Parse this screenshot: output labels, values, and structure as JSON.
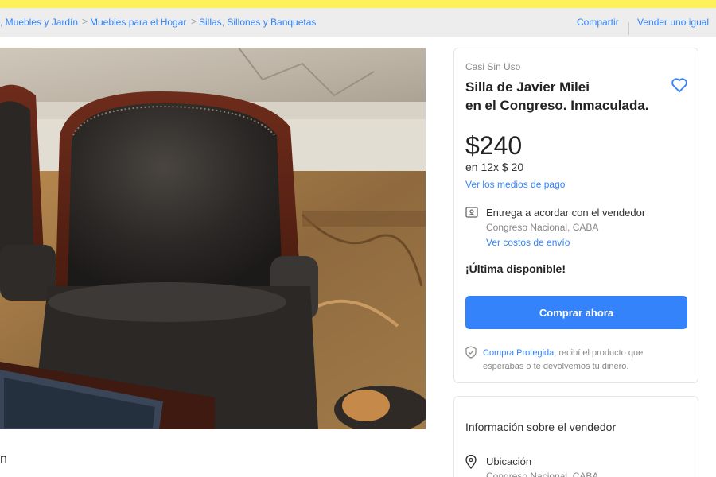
{
  "breadcrumb": {
    "items": [
      ", Muebles y Jardín",
      "Muebles para el Hogar",
      "Sillas, Sillones y Banquetas"
    ],
    "separator": ">"
  },
  "actions": {
    "share": "Compartir",
    "sell": "Vender uno igual"
  },
  "product": {
    "condition": "Casi Sin Uso",
    "title_line1": "Silla de Javier Milei",
    "title_line2": "en el Congreso. Inmaculada.",
    "price": "$240",
    "installments": "en 12x $ 20",
    "payment_link": "Ver los medios de pago",
    "favorite_icon": "heart-icon"
  },
  "shipping": {
    "icon": "delivery-card-icon",
    "title": "Entrega a acordar con el vendedor",
    "location": "Congreso Nacional, CABA",
    "costs_link": "Ver costos de envío"
  },
  "stock": {
    "label": "¡Última disponible!"
  },
  "buy": {
    "label": "Comprar ahora"
  },
  "protection": {
    "link": "Compra Protegida",
    "text": ", recibí el producto que esperabas o te devolvemos tu dinero."
  },
  "seller": {
    "title": "Información sobre el vendedor",
    "location_label": "Ubicación",
    "location_value": "Congreso Nacional, CABA"
  },
  "description_cutoff": "n",
  "colors": {
    "brand_yellow": "#fff159",
    "accent_blue": "#3483fa"
  }
}
